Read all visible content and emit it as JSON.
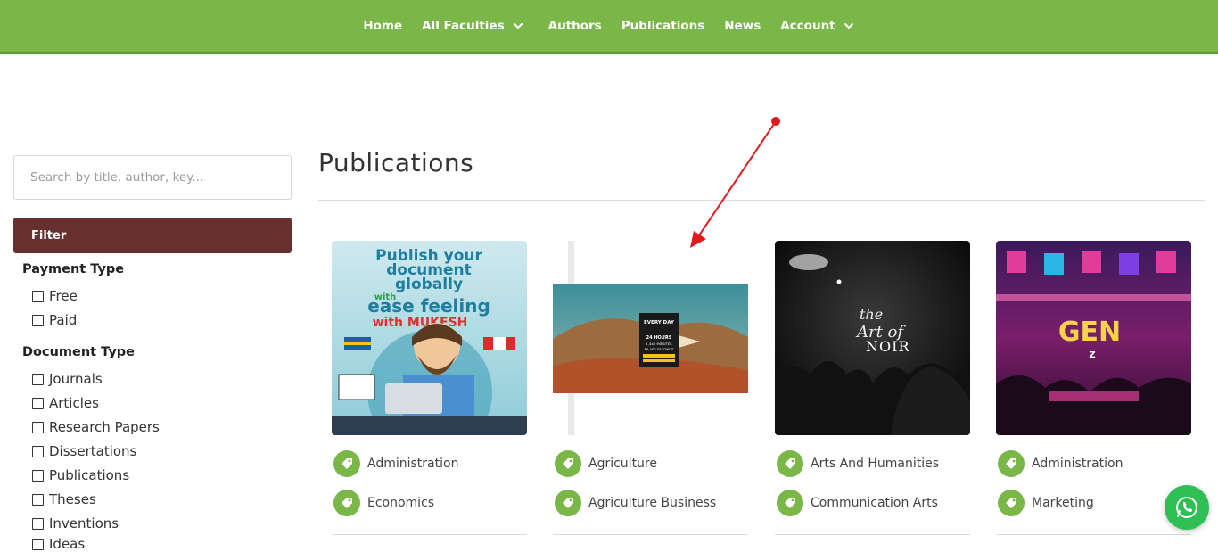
{
  "nav": {
    "items": [
      {
        "label": "Home",
        "dropdown": false
      },
      {
        "label": "All Faculties",
        "dropdown": true
      },
      {
        "label": "Authors",
        "dropdown": false
      },
      {
        "label": "Publications",
        "dropdown": false
      },
      {
        "label": "News",
        "dropdown": false
      },
      {
        "label": "Account",
        "dropdown": true
      }
    ]
  },
  "sidebar": {
    "search_placeholder": "Search by title, author, key...",
    "filter_label": "Filter",
    "payment_type": {
      "title": "Payment Type",
      "options": [
        "Free",
        "Paid"
      ]
    },
    "document_type": {
      "title": "Document Type",
      "options": [
        "Journals",
        "Articles",
        "Research Papers",
        "Dissertations",
        "Publications",
        "Theses",
        "Inventions",
        "Ideas"
      ]
    }
  },
  "main": {
    "title": "Publications",
    "cards": [
      {
        "cover_text": [
          "Publish your",
          "document",
          "globally",
          "with",
          "ease feeling",
          "with MUKESH"
        ],
        "tags": [
          "Administration",
          "Economics"
        ]
      },
      {
        "cover_text": [
          "EVERY DAY",
          "24 HOURS",
          "1,440 MINUTES",
          "86,400 SECONDS"
        ],
        "tags": [
          "Agriculture",
          "Agriculture Business"
        ]
      },
      {
        "cover_text": [
          "the",
          "Art of",
          "NOIR"
        ],
        "tags": [
          "Arts And Humanities",
          "Communication Arts"
        ]
      },
      {
        "cover_text": [
          "GEN",
          "Z"
        ],
        "tags": [
          "Administration",
          "Marketing"
        ]
      }
    ]
  },
  "colors": {
    "topbar": "#7ab648",
    "filter": "#67302f",
    "tag_badge": "#7ab648",
    "whatsapp": "#2fbf55",
    "arrow": "#e0191b"
  },
  "icons": {
    "chevron": "chevron-down-icon",
    "tag": "tag-icon",
    "whatsapp": "whatsapp-icon",
    "checkbox": "checkbox-icon"
  }
}
